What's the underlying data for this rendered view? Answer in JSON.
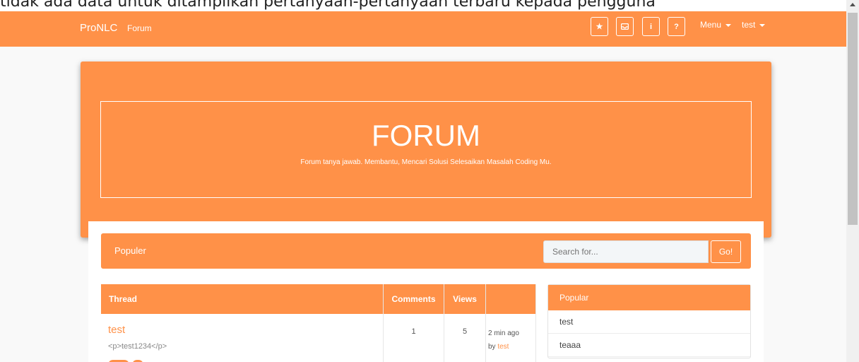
{
  "caption": "tidak ada data untuk ditampilkan pertanyaan-pertanyaan terbaru kepada pengguna",
  "navbar": {
    "brand": "ProNLC",
    "forum_link": "Forum",
    "icons": [
      {
        "name": "star-icon",
        "glyph": "★"
      },
      {
        "name": "inbox-icon",
        "glyph": "⌂"
      },
      {
        "name": "info-icon",
        "glyph": "i"
      },
      {
        "name": "help-icon",
        "glyph": "?"
      }
    ],
    "menu_label": "Menu",
    "user_label": "test"
  },
  "jumbotron": {
    "title": "FORUM",
    "subtitle": "Forum tanya jawab. Membantu, Mencari Solusi Selesaikan Masalah Coding Mu."
  },
  "populer_bar": {
    "label": "Populer",
    "search_placeholder": "Search for...",
    "go_label": "Go!"
  },
  "thread_table": {
    "headers": [
      "Thread",
      "Comments",
      "Views",
      ""
    ],
    "rows": [
      {
        "title": "test",
        "excerpt": "<p>test1234</p>",
        "comments": "1",
        "views": "5",
        "time": "2 min ago",
        "by_prefix": "by",
        "author": "test"
      }
    ]
  },
  "popular_panel": {
    "title": "Popular",
    "items": [
      "test",
      "teaaa"
    ]
  },
  "colors": {
    "accent": "#ff9148"
  }
}
